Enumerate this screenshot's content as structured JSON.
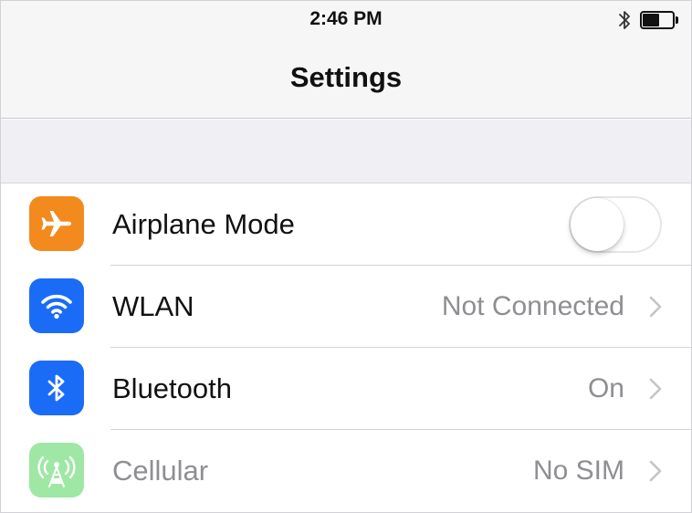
{
  "status_bar": {
    "time": "2:46 PM",
    "icons": [
      "bluetooth-icon",
      "battery-icon"
    ]
  },
  "nav": {
    "title": "Settings"
  },
  "colors": {
    "airplane": "#f28a1e",
    "wlan": "#1a6cf6",
    "bluetooth": "#1a6cf6",
    "cellular": "#9ee7a4",
    "toggle_off_border": "#e5e5ea",
    "secondary_text": "#8e8e93"
  },
  "settings": {
    "rows": [
      {
        "label": "Airplane Mode",
        "icon": "airplane-icon",
        "control": "toggle",
        "toggle_on": false
      },
      {
        "label": "WLAN",
        "icon": "wifi-icon",
        "value": "Not Connected",
        "control": "chevron"
      },
      {
        "label": "Bluetooth",
        "icon": "bluetooth-icon",
        "value": "On",
        "control": "chevron"
      },
      {
        "label": "Cellular",
        "icon": "cellular-antenna-icon",
        "value": "No SIM",
        "control": "chevron",
        "disabled": true
      }
    ]
  }
}
